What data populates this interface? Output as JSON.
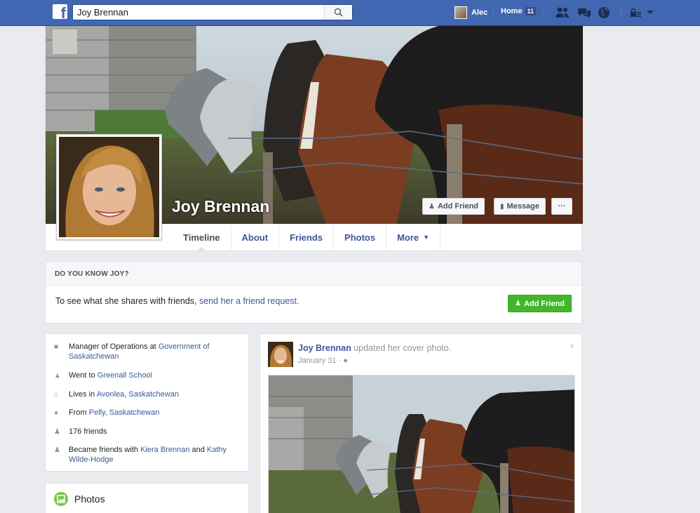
{
  "topbar": {
    "logo": "f",
    "search_value": "Joy Brennan",
    "user_name": "Alec",
    "home_label": "Home",
    "home_count": "11",
    "icons": [
      "friend-requests-icon",
      "messages-icon",
      "notifications-globe-icon",
      "privacy-lock-icon",
      "account-menu-icon"
    ]
  },
  "profile": {
    "name": "Joy Brennan",
    "add_friend_label": "Add Friend",
    "message_label": "Message",
    "more_label": "···"
  },
  "tabs": [
    {
      "label": "Timeline"
    },
    {
      "label": "About"
    },
    {
      "label": "Friends"
    },
    {
      "label": "Photos"
    },
    {
      "label": "More"
    }
  ],
  "know": {
    "header": "DO YOU KNOW JOY?",
    "text": "To see what she shares with friends,",
    "link": "send her a friend request.",
    "button": "Add Friend"
  },
  "intro": {
    "work_prefix": "Manager of Operations at",
    "work_link": "Government of Saskatchewan",
    "school_prefix": "Went to",
    "school_link": "Greenall School",
    "lives_prefix": "Lives in",
    "lives_link": "Avonlea, Saskatchewan",
    "from_prefix": "From",
    "from_link": "Pelly, Saskatchewan",
    "friends_count": "176 friends",
    "became_prefix": "Became friends with",
    "became_link1": "Kiera Brennan",
    "became_and": "and",
    "became_link2": "Kathy Wilde-Hodge"
  },
  "photos": {
    "title": "Photos"
  },
  "post": {
    "author": "Joy Brennan",
    "action": "updated her cover photo.",
    "date": "January 31",
    "privacy_icon": "public-globe-icon"
  },
  "colors": {
    "topbar": "#4267b2",
    "link": "#3b5998",
    "green": "#42b72a",
    "background": "#e9ebee"
  }
}
